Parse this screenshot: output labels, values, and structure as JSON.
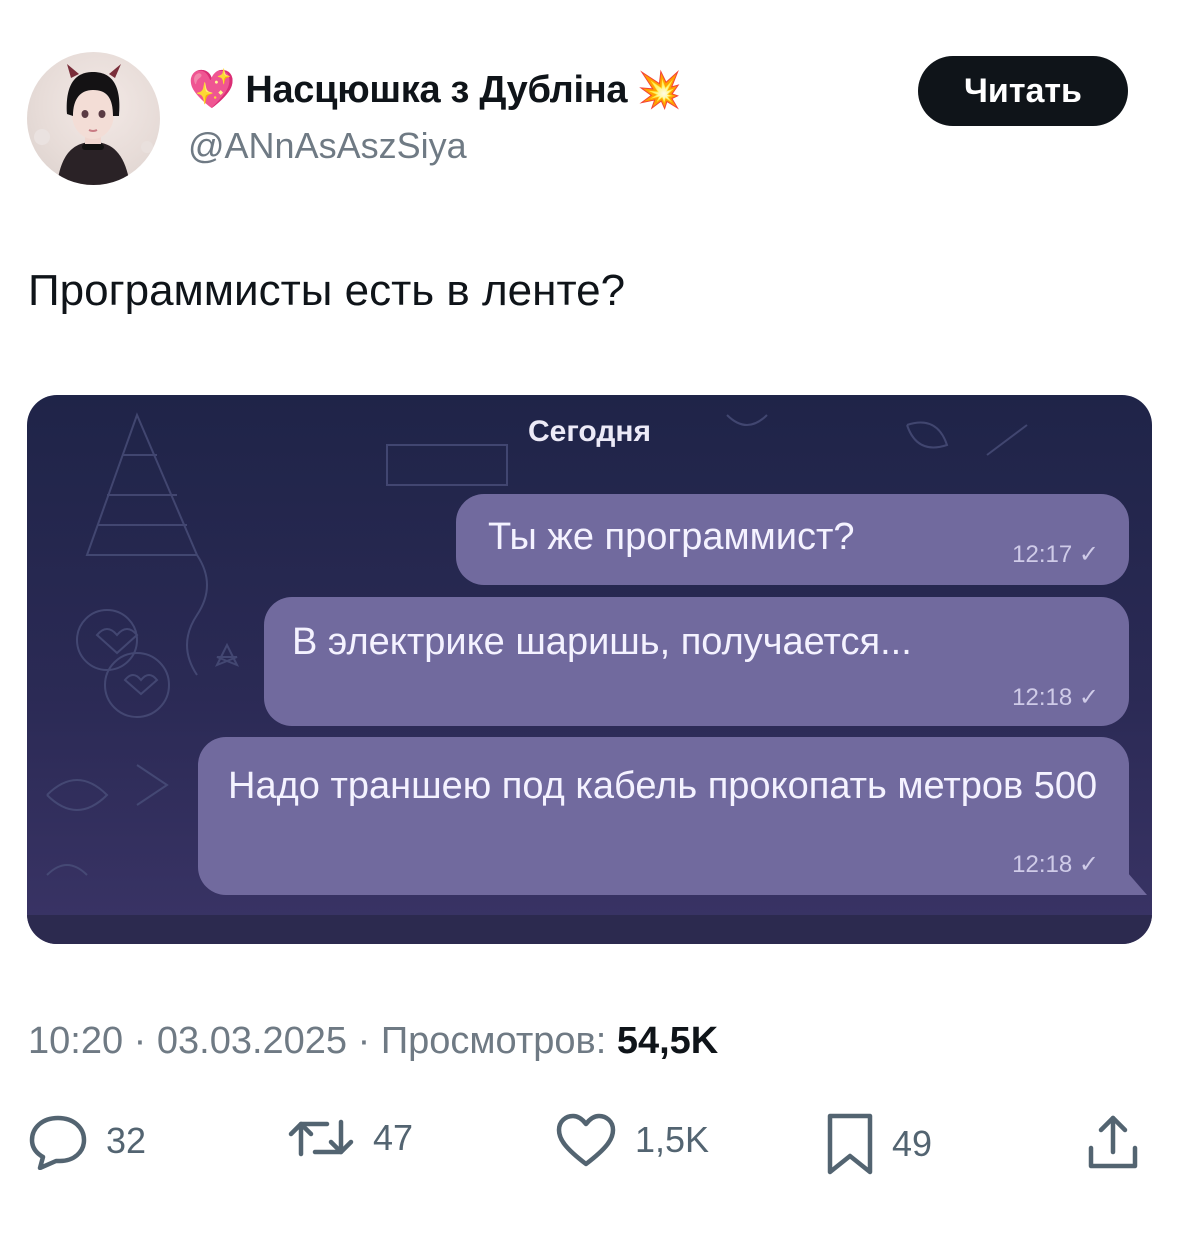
{
  "author": {
    "display_name": "Насцюшка з Дубліна",
    "name_prefix_emoji": "💖",
    "name_suffix_emoji": "💥",
    "handle": "@ANnAsAszSiya"
  },
  "follow_button": {
    "label": "Читать"
  },
  "tweet": {
    "text": "Программисты есть в ленте?"
  },
  "media": {
    "date_chip": "Сегодня",
    "messages": [
      {
        "text": "Ты же программист?",
        "time": "12:17"
      },
      {
        "text": "В электрике шаришь, получается...",
        "time": "12:18"
      },
      {
        "text": "Надо траншею под кабель прокопать метров 500",
        "time": "12:18"
      }
    ]
  },
  "meta": {
    "time": "10:20",
    "sep1": " · ",
    "date": "03.03.2025",
    "sep2": " · ",
    "views_label": "Просмотров: ",
    "views_value": "54,5K"
  },
  "actions": {
    "replies": "32",
    "reposts": "47",
    "likes": "1,5K",
    "bookmarks": "49"
  },
  "colors": {
    "text_primary": "#0f1419",
    "text_secondary": "#6f7a84",
    "bubble": "#716a9e",
    "chat_background": "#2b2a55"
  }
}
